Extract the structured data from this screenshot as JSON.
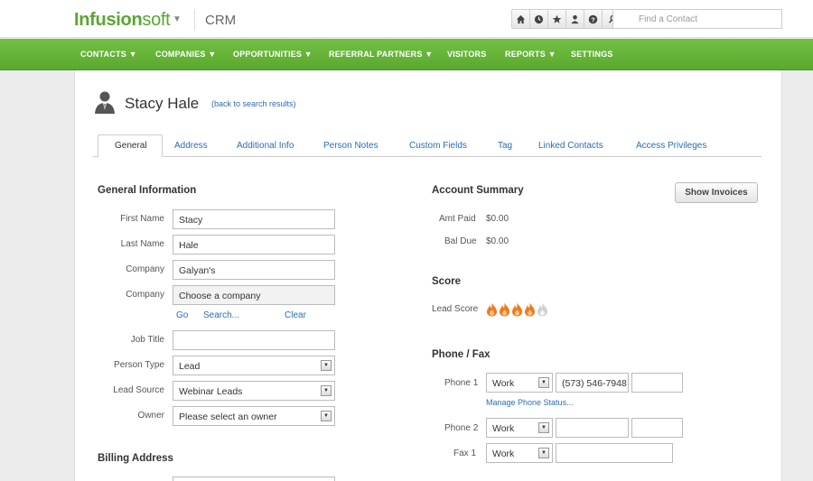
{
  "app": {
    "logo_bold": "Infusion",
    "logo_light": "soft",
    "section": "CRM"
  },
  "search": {
    "placeholder": "Find a Contact"
  },
  "icons": [
    "home-icon",
    "clock-icon",
    "star-icon",
    "person-icon",
    "help-icon",
    "search-icon"
  ],
  "nav": [
    "CONTACTS ▼",
    "COMPANIES ▼",
    "OPPORTUNITIES ▼",
    "REFERRAL PARTNERS ▼",
    "VISITORS",
    "REPORTS ▼",
    "SETTINGS"
  ],
  "contact": {
    "name": "Stacy Hale",
    "back_link": "(back to search results)"
  },
  "tabs": [
    "General",
    "Address",
    "Additional Info",
    "Person Notes",
    "Custom Fields",
    "Tag",
    "Linked Contacts",
    "Access Privileges"
  ],
  "general": {
    "heading": "General Information",
    "first_name_label": "First Name",
    "first_name": "Stacy",
    "last_name_label": "Last Name",
    "last_name": "Hale",
    "company_label": "Company",
    "company": "Galyan's",
    "company2_label": "Company",
    "company2": "Choose a company",
    "go": "Go",
    "search_link": "Search...",
    "clear": "Clear",
    "job_title_label": "Job Title",
    "job_title": "",
    "person_type_label": "Person Type",
    "person_type": "Lead",
    "lead_source_label": "Lead Source",
    "lead_source": "Webinar Leads",
    "owner_label": "Owner",
    "owner": "Please select an owner"
  },
  "billing": {
    "heading": "Billing Address"
  },
  "account": {
    "heading": "Account Summary",
    "show_invoices": "Show Invoices",
    "amt_paid_label": "Amt Paid",
    "amt_paid": "$0.00",
    "bal_due_label": "Bal Due",
    "bal_due": "$0.00"
  },
  "score": {
    "heading": "Score",
    "label": "Lead Score",
    "value": 4,
    "max": 5,
    "color_on": "#f07a1a",
    "color_off": "#d0d0d0"
  },
  "phone": {
    "heading": "Phone / Fax",
    "phone1_label": "Phone 1",
    "phone1_type": "Work",
    "phone1_number": "(573) 546-7948",
    "manage_status": "Manage Phone Status...",
    "phone2_label": "Phone 2",
    "phone2_type": "Work",
    "fax1_label": "Fax 1",
    "fax1_type": "Work"
  },
  "colors": {
    "brand_green": "#5aa632",
    "link_blue": "#2a6db5"
  }
}
